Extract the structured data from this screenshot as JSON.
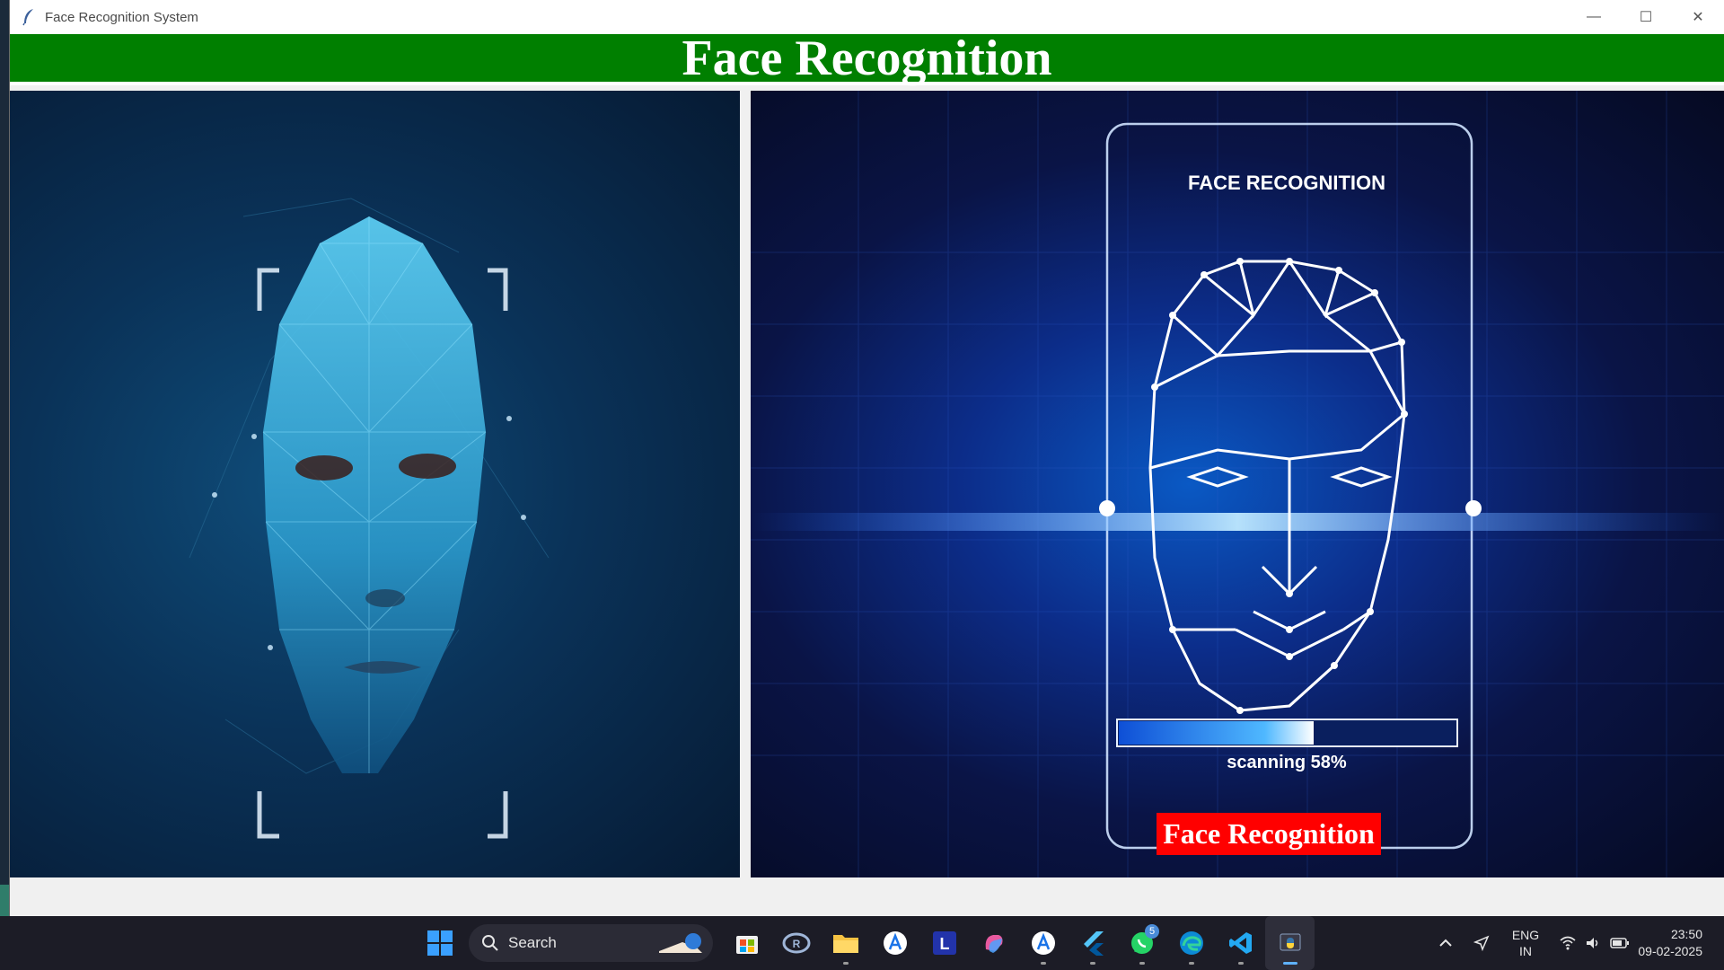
{
  "window": {
    "title": "Face Recognition System",
    "controls": {
      "minimize": "—",
      "maximize": "☐",
      "close": "✕"
    }
  },
  "banner": {
    "heading": "Face Recognition",
    "color": "#007f00"
  },
  "left_image": {
    "icon": "polygon-face-illustration"
  },
  "right_image": {
    "icon": "face-scan-illustration",
    "card_title": "FACE RECOGNITION",
    "scan_text": "scanning 58%",
    "scan_progress": 0.58,
    "button_label": "Face Recognition",
    "button_color": "#ff0000"
  },
  "taskbar": {
    "search_label": "Search",
    "apps": [
      {
        "name": "microsoft-store-icon"
      },
      {
        "name": "copilot-app-icon"
      },
      {
        "name": "file-explorer-icon"
      },
      {
        "name": "app-a-icon"
      },
      {
        "name": "app-l-icon"
      },
      {
        "name": "copilot-icon"
      },
      {
        "name": "app-a2-icon"
      },
      {
        "name": "flutter-icon"
      },
      {
        "name": "whatsapp-icon",
        "badge": "5"
      },
      {
        "name": "edge-icon"
      },
      {
        "name": "vscode-icon"
      },
      {
        "name": "python-icon"
      }
    ],
    "tray": {
      "lang_line1": "ENG",
      "lang_line2": "IN",
      "time": "23:50",
      "date": "09-02-2025"
    }
  }
}
